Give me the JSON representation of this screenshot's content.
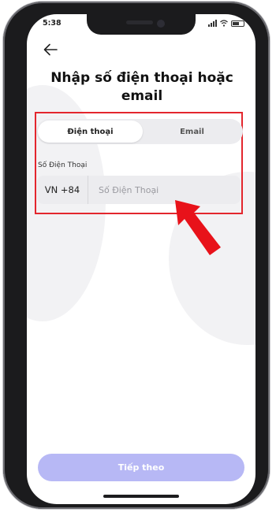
{
  "status_bar": {
    "time": "5:38"
  },
  "header": {
    "title": "Nhập số điện thoại hoặc email"
  },
  "tabs": [
    {
      "label": "Điện thoại",
      "active": true
    },
    {
      "label": "Email",
      "active": false
    }
  ],
  "form": {
    "phone_label": "Số Điện Thoại",
    "country_code": "VN +84",
    "phone_placeholder": "Số Điện Thoại"
  },
  "footer": {
    "next_label": "Tiếp theo"
  },
  "colors": {
    "highlight": "#e3262d",
    "primary_disabled": "#b7b8f5",
    "annotation_arrow": "#e8121a"
  },
  "icons": {
    "back": "arrow-left-icon",
    "annotation": "red-pointer-arrow"
  }
}
